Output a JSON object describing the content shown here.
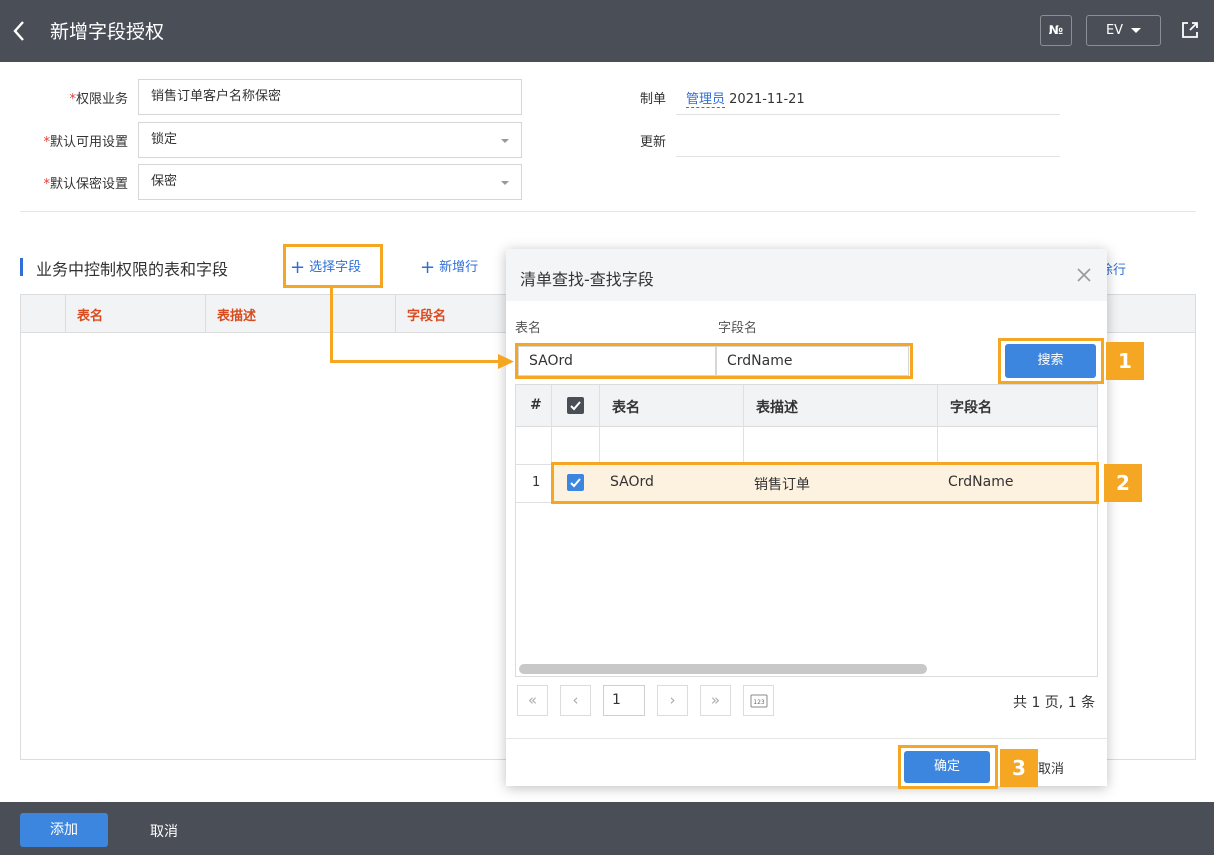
{
  "header": {
    "title": "新增字段授权",
    "no_label": "№",
    "lang_label": "EV"
  },
  "form": {
    "perm_business": {
      "label": "权限业务",
      "value": "销售订单客户名称保密"
    },
    "default_available": {
      "label": "默认可用设置",
      "value": "锁定"
    },
    "default_secret": {
      "label": "默认保密设置",
      "value": "保密"
    },
    "maker": {
      "label": "制单",
      "user": "管理员",
      "date": "2021-11-21"
    },
    "update": {
      "label": "更新",
      "value": ""
    },
    "required_mark": "*"
  },
  "section": {
    "title": "业务中控制权限的表和字段",
    "select_field": "选择字段",
    "add_row": "新增行",
    "delete_row_partial": "徐行",
    "columns": [
      "表名",
      "表描述",
      "字段名"
    ]
  },
  "dialog": {
    "title": "清单查找-查找字段",
    "table_label": "表名",
    "field_label": "字段名",
    "table_value": "SAOrd",
    "field_value": "CrdName",
    "search_button": "搜索",
    "columns": {
      "num": "#",
      "table": "表名",
      "desc": "表描述",
      "field": "字段名"
    },
    "rows": [
      {
        "num": "1",
        "table": "SAOrd",
        "desc": "销售订单",
        "field": "CrdName"
      }
    ],
    "pager": {
      "first": "«",
      "prev": "‹",
      "page": "1",
      "next": "›",
      "last": "»",
      "total": "共 1 页, 1 条"
    },
    "ok_button": "确定",
    "cancel_partial": "取消"
  },
  "annotations": {
    "step1": "1",
    "step2": "2",
    "step3": "3",
    "color": "#f5a623"
  },
  "footer": {
    "add_button": "添加",
    "cancel_button": "取消"
  },
  "colors": {
    "topbar": "#4a4f57",
    "primary": "#3d86e0",
    "link": "#2f6fd7",
    "header_text": "#d94a1e",
    "highlight": "#f5a623"
  }
}
